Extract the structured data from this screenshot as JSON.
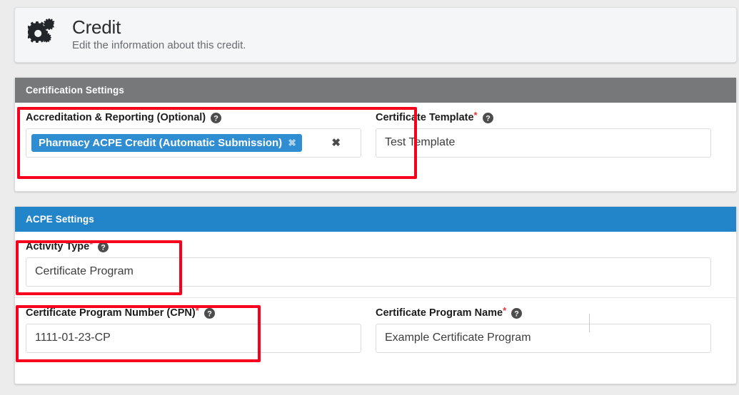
{
  "header": {
    "icon": "cogs-icon",
    "title": "Credit",
    "subtitle": "Edit the information about this credit."
  },
  "sections": [
    {
      "id": "certification-settings",
      "title": "Certification Settings",
      "accent": "#77787a",
      "fields": {
        "accreditation": {
          "label": "Accreditation & Reporting (Optional)",
          "required": false,
          "help_icon": "help-circle-icon",
          "tags": [
            {
              "label": "Pharmacy ACPE Credit (Automatic Submission)",
              "remove_icon": "remove-tag-icon"
            }
          ],
          "clear_icon": "clear-selection-icon"
        },
        "certificate_template": {
          "label": "Certificate Template",
          "required": true,
          "required_mark": "*",
          "help_icon": "help-circle-icon",
          "value": "Test Template"
        }
      }
    },
    {
      "id": "acpe-settings",
      "title": "ACPE Settings",
      "accent": "#2385c9",
      "fields": {
        "activity_type": {
          "label": "Activity Type",
          "required": true,
          "required_mark": "*",
          "help_icon": "help-circle-icon",
          "value": "Certificate Program"
        },
        "certificate_program_number": {
          "label": "Certificate Program Number (CPN)",
          "required": true,
          "required_mark": "*",
          "help_icon": "help-circle-icon",
          "value": "1111-01-23-CP"
        },
        "certificate_program_name": {
          "label": "Certificate Program Name",
          "required": true,
          "required_mark": "*",
          "help_icon": "help-circle-icon",
          "value": "Example Certificate Program"
        }
      }
    }
  ],
  "annotations": {
    "highlight_color": "#f6001e",
    "boxes": [
      "accreditation",
      "activity-type",
      "certificate-program-number"
    ]
  },
  "colors": {
    "page_background": "#ececec",
    "panel_background": "#ffffff",
    "grey_header": "#77787a",
    "blue_header": "#2385c9",
    "tag_blue": "#2f8ed1",
    "required_red": "#e03a3a",
    "annotation_red": "#f6001e"
  }
}
